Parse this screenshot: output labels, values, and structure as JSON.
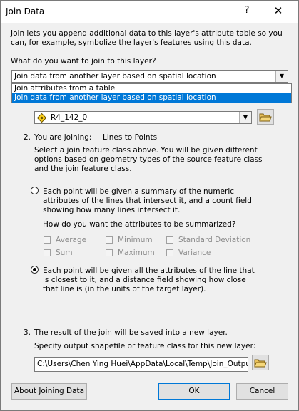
{
  "window": {
    "title": "Join Data",
    "help": "?",
    "close": "✕"
  },
  "intro": "Join lets you append additional data to this layer's attribute table so you can, for example, symbolize the layer's features using this data.",
  "question": "What do you want to join to this layer?",
  "join_type": {
    "selected": "Join data from another layer based on spatial location",
    "options": [
      "Join attributes from a table",
      "Join data from another layer based on spatial location"
    ]
  },
  "layer_combo": {
    "value": "R4_142_0"
  },
  "step2": {
    "num": "2.",
    "label": "You are joining:",
    "value": "Lines to Points",
    "desc": "Select a join feature class above.  You will be given different options based on geometry types of the source feature class and the join feature class."
  },
  "option_summary": {
    "text": "Each point will be given a summary of the numeric attributes of the lines that intersect it, and a count field showing how many lines intersect it.",
    "selected": false
  },
  "summarize": {
    "question": "How do you want the attributes to be summarized?",
    "checkboxes": [
      "Average",
      "Minimum",
      "Standard Deviation",
      "Sum",
      "Maximum",
      "Variance"
    ]
  },
  "option_closest": {
    "text": "Each point will be given all the attributes of the line that is closest to it, and a distance field showing how close that line is (in the units of the target layer).",
    "selected": true
  },
  "step3": {
    "num": "3.",
    "text": "The result of the join will be saved into a new layer.",
    "specify": "Specify output shapefile or feature class for this new layer:",
    "path": "C:\\Users\\Chen Ying Huei\\AppData\\Local\\Temp\\Join_Output"
  },
  "buttons": {
    "about": "About Joining Data",
    "ok": "OK",
    "cancel": "Cancel"
  },
  "colors": {
    "selection": "#0078d7",
    "dialog_bg": "#f0f0f0"
  }
}
